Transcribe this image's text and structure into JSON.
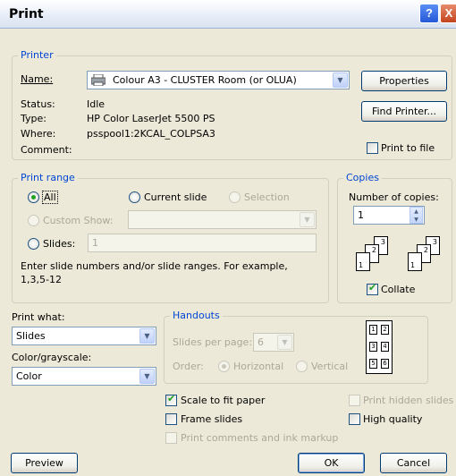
{
  "window": {
    "title": "Print"
  },
  "titlebar": {
    "help_glyph": "?",
    "close_glyph": "X"
  },
  "printer": {
    "legend": "Printer",
    "name_label": "Name:",
    "name_value": "Colour A3 - CLUSTER Room (or OLUA)",
    "properties_label": "Properties",
    "find_printer_label": "Find Printer...",
    "status_label": "Status:",
    "status_value": "Idle",
    "type_label": "Type:",
    "type_value": "HP Color LaserJet 5500 PS",
    "where_label": "Where:",
    "where_value": "psspool1:2KCAL_COLPSA3",
    "comment_label": "Comment:",
    "print_to_file_label": "Print to file"
  },
  "print_range": {
    "legend": "Print range",
    "all_label": "All",
    "current_slide_label": "Current slide",
    "selection_label": "Selection",
    "custom_show_label": "Custom Show:",
    "slides_label": "Slides:",
    "slides_value": "1",
    "hint_line1": "Enter slide numbers and/or slide ranges. For example,",
    "hint_line2": "1,3,5-12"
  },
  "copies": {
    "legend": "Copies",
    "number_label": "Number of copies:",
    "number_value": "1",
    "collate_label": "Collate",
    "page_labels": [
      "1",
      "2",
      "3"
    ]
  },
  "print_what": {
    "label": "Print what:",
    "value": "Slides",
    "color_label": "Color/grayscale:",
    "color_value": "Color"
  },
  "handouts": {
    "legend": "Handouts",
    "slides_per_page_label": "Slides per page:",
    "slides_per_page_value": "6",
    "order_label": "Order:",
    "horizontal_label": "Horizontal",
    "vertical_label": "Vertical",
    "preview_numbers": [
      "1",
      "2",
      "3",
      "4",
      "5",
      "6"
    ]
  },
  "options": {
    "scale_label": "Scale to fit paper",
    "frame_label": "Frame slides",
    "comments_label": "Print comments and ink markup",
    "hidden_label": "Print hidden slides",
    "high_quality_label": "High quality"
  },
  "buttons": {
    "preview": "Preview",
    "ok": "OK",
    "cancel": "Cancel"
  }
}
